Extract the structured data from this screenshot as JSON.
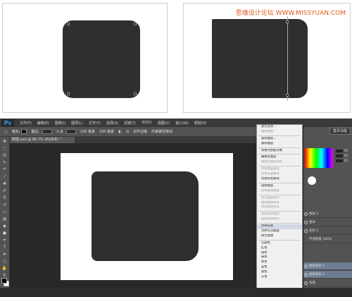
{
  "watermark": "思缘设计论坛 WWW.MISSYUAN.COM",
  "ps": {
    "logo": "Ps",
    "menu": [
      "文件(F)",
      "编辑(E)",
      "图像(I)",
      "图层(L)",
      "文字(Y)",
      "选择(S)",
      "滤镜(T)",
      "3D(D)",
      "视图(V)",
      "窗口(W)",
      "帮助(H)"
    ],
    "options": {
      "fill_label": "填充:",
      "stroke_label": "描边:",
      "stroke_width": "3 点",
      "w_value": "100 像素",
      "h_value": "100 像素",
      "align_edges": "对齐边缘",
      "constrain": "约束路径拖动"
    },
    "doc_tab": "截图.psd @ 66.7% (RGB/8) *",
    "workspace": "基本功能",
    "context_menu": [
      {
        "label": "混合选项...",
        "state": "normal"
      },
      {
        "label": "编辑调整...",
        "state": "disabled"
      },
      {
        "sep": true
      },
      {
        "label": "复制图层...",
        "state": "normal"
      },
      {
        "label": "删除图层",
        "state": "normal"
      },
      {
        "sep": true
      },
      {
        "label": "转换为智能对象",
        "state": "normal"
      },
      {
        "sep": true
      },
      {
        "label": "栅格化图层",
        "state": "normal"
      },
      {
        "label": "栅格化图层样式",
        "state": "disabled"
      },
      {
        "sep": true
      },
      {
        "label": "停用图层蒙版",
        "state": "disabled"
      },
      {
        "label": "启用矢量蒙版",
        "state": "disabled"
      },
      {
        "label": "创建剪贴蒙版",
        "state": "normal"
      },
      {
        "sep": true
      },
      {
        "label": "链接图层",
        "state": "normal"
      },
      {
        "label": "选择链接图层",
        "state": "disabled"
      },
      {
        "sep": true
      },
      {
        "label": "拷贝图层样式",
        "state": "disabled"
      },
      {
        "label": "粘贴图层样式",
        "state": "disabled"
      },
      {
        "label": "清除图层样式",
        "state": "disabled"
      },
      {
        "sep": true
      },
      {
        "label": "复制形状属性",
        "state": "disabled"
      },
      {
        "label": "粘贴形状属性",
        "state": "disabled"
      },
      {
        "sep": true
      },
      {
        "label": "合并形状",
        "state": "highlight"
      },
      {
        "label": "合并可见图层",
        "state": "normal"
      },
      {
        "label": "拼合图像",
        "state": "normal"
      },
      {
        "sep": true
      },
      {
        "label": "无颜色",
        "state": "normal"
      },
      {
        "label": "红色",
        "state": "normal"
      },
      {
        "label": "橙色",
        "state": "normal"
      },
      {
        "label": "黄色",
        "state": "normal"
      },
      {
        "label": "绿色",
        "state": "normal"
      },
      {
        "label": "蓝色",
        "state": "normal"
      },
      {
        "label": "紫色",
        "state": "normal"
      },
      {
        "label": "灰色",
        "state": "normal"
      }
    ],
    "color_rows": [
      "65",
      "65",
      "65"
    ],
    "layers": [
      {
        "label": "图层 2",
        "selected": false
      },
      {
        "label": "基本",
        "selected": false
      },
      {
        "label": "形状 1",
        "selected": false
      },
      {
        "label": "不透明度 100%",
        "selected": false
      },
      {
        "label": "圆角矩形 1",
        "selected": true
      },
      {
        "label": "圆角矩形 2",
        "selected": true
      },
      {
        "label": "背景",
        "selected": false
      }
    ]
  },
  "colors": {
    "shape": "#2f2f2f",
    "ps_bg": "#4b4b4b",
    "watermark": "#e05a1e",
    "highlight": "#d2d9e4"
  }
}
